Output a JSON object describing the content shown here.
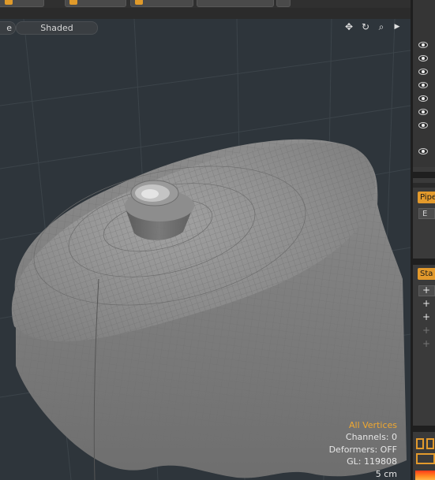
{
  "viewport": {
    "mode_left": "e",
    "shading_mode": "Shaded",
    "icons": [
      "move-view-icon",
      "rotate-view-icon",
      "zoom-view-icon",
      "play-icon"
    ]
  },
  "hud": {
    "selection_mode": "All Vertices",
    "channels": "Channels: 0",
    "deformers": "Deformers: OFF",
    "gl": "GL: 119808",
    "scale": "5 cm"
  },
  "right_panel": {
    "pipe_tab": "Pipe",
    "pipe_cell": "E",
    "stack_tab": "Sta",
    "stack_items": [
      "+",
      "+",
      "+",
      "+",
      "+"
    ]
  },
  "colors": {
    "accent": "#e39a2c",
    "viewport_bg": "#2e353b",
    "mesh": "#8a8a8a"
  }
}
